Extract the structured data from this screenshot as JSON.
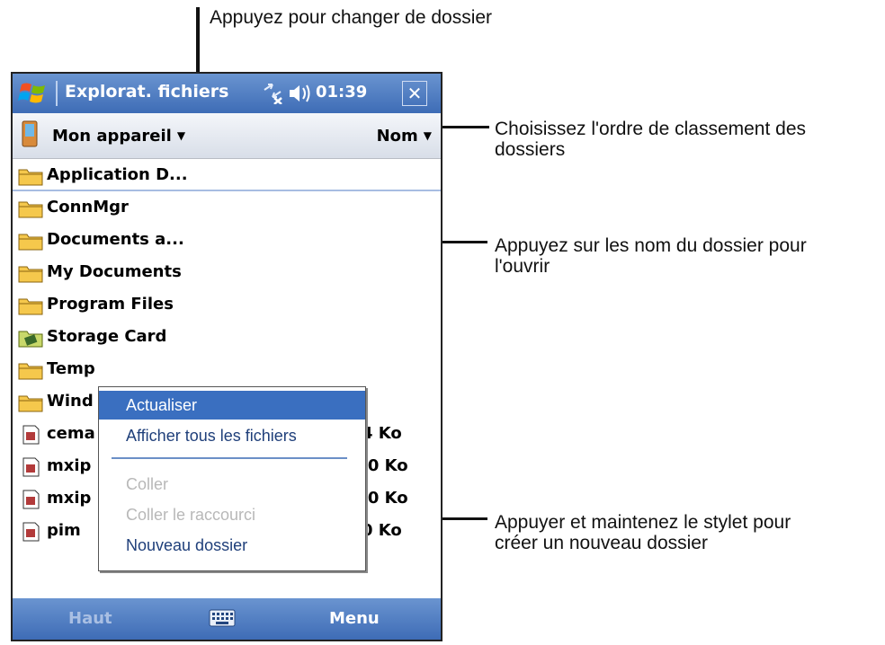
{
  "callouts": {
    "top": "Appuyez pour changer de dossier",
    "sort_line1": "Choisissez l'ordre de classement des",
    "sort_line2": "dossiers",
    "open_line1": "Appuyez sur les nom du dossier pour",
    "open_line2": "l'ouvrir",
    "stylus_line1": "Appuyer et maintenez le stylet pour",
    "stylus_line2": "créer un nouveau dossier"
  },
  "titlebar": {
    "title": "Explorat. fichiers",
    "time": "01:39",
    "close": "✕",
    "icons": [
      "windows-start-icon",
      "network-icon",
      "volume-icon"
    ]
  },
  "pathbar": {
    "location": "Mon appareil",
    "sort": "Nom",
    "icons": [
      "device-icon",
      "chevron-down-icon"
    ]
  },
  "files": [
    {
      "name": "Application D...",
      "type": "folder",
      "size": ""
    },
    {
      "name": "ConnMgr",
      "type": "folder",
      "size": ""
    },
    {
      "name": "Documents a...",
      "type": "folder",
      "size": ""
    },
    {
      "name": "My Documents",
      "type": "folder",
      "size": ""
    },
    {
      "name": "Program Files",
      "type": "folder",
      "size": ""
    },
    {
      "name": "Storage Card",
      "type": "storage",
      "size": ""
    },
    {
      "name": "Temp",
      "type": "folder",
      "size": ""
    },
    {
      "name": "Wind",
      "type": "folder",
      "size": ""
    },
    {
      "name": "cema",
      "type": "file",
      "size": "4 Ko"
    },
    {
      "name": "mxip",
      "type": "file",
      "size": ",0 Ko"
    },
    {
      "name": "mxip",
      "type": "file",
      "size": ",0 Ko"
    },
    {
      "name": "pim",
      "type": "file",
      "size": "0 Ko"
    }
  ],
  "context_menu": {
    "items": [
      {
        "label": "Actualiser",
        "state": "highlighted"
      },
      {
        "label": "Afficher tous les fichiers",
        "state": "normal"
      },
      {
        "label": "Coller",
        "state": "disabled"
      },
      {
        "label": "Coller le raccourci",
        "state": "disabled"
      },
      {
        "label": "Nouveau dossier",
        "state": "normal"
      }
    ]
  },
  "bottombar": {
    "left": "Haut",
    "right": "Menu",
    "icons": [
      "keyboard-icon"
    ]
  },
  "colors": {
    "titlebar": "#3e6cb6",
    "highlight": "#3a6fc0",
    "folder": "#f5c84c"
  }
}
